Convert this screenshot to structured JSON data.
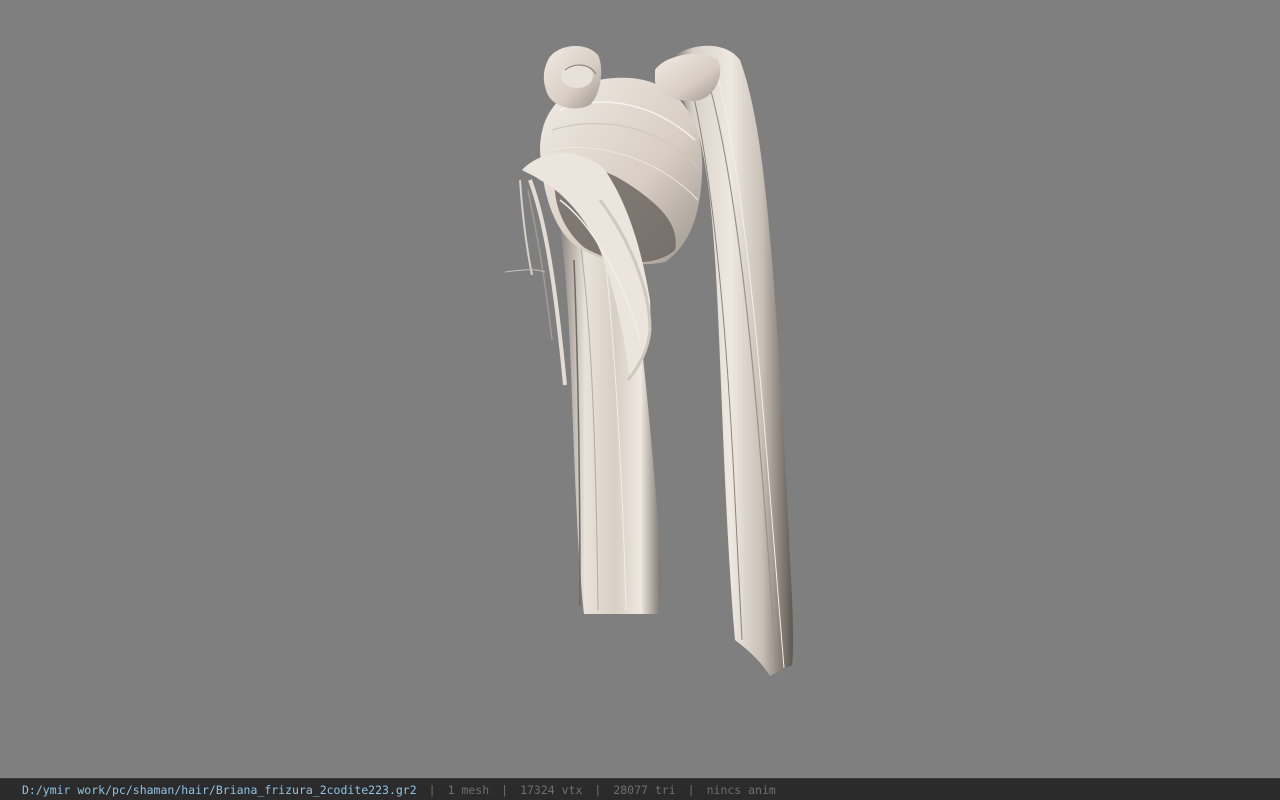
{
  "viewport": {
    "background_color": "#7f7f7f",
    "model_color": "#e6ded6"
  },
  "status_bar": {
    "file_path": "D:/ymir work/pc/shaman/hair/Briana_frizura_2codite223.gr2",
    "separator": "|",
    "mesh_count": "1 mesh",
    "vertex_count": "17324 vtx",
    "triangle_count": "28077 tri",
    "anim_status": "nincs anim"
  }
}
